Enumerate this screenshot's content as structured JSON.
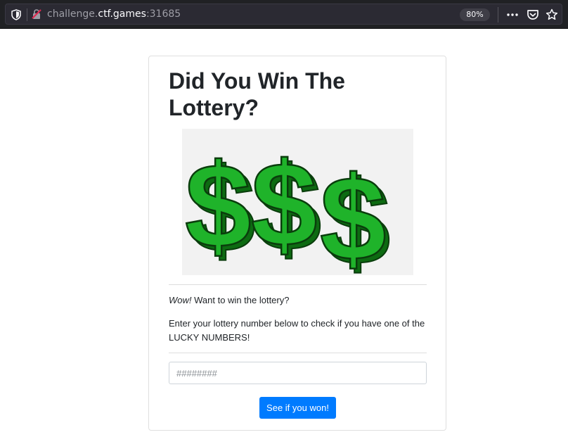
{
  "browser": {
    "url_prefix": "challenge.",
    "url_host": "ctf.games",
    "url_port": ":31685",
    "zoom_level": "80%",
    "icons": [
      "tracking-shield-icon",
      "insecure-lock-icon",
      "more-actions-icon",
      "pocket-icon",
      "bookmark-star-icon"
    ]
  },
  "page": {
    "title": "Did You Win The Lottery?",
    "hero_image": "dollar-signs-image",
    "intro_emphasis": "Wow!",
    "intro_text": " Want to win the lottery?",
    "description": "Enter your lottery number below to check if you have one of the LUCKY NUMBERS!",
    "input_placeholder": "########",
    "input_value": "",
    "submit_label": "See if you won!"
  },
  "colors": {
    "accent": "#007bff",
    "dollar_green": "#1aa31a",
    "chrome_bg": "#202124"
  }
}
